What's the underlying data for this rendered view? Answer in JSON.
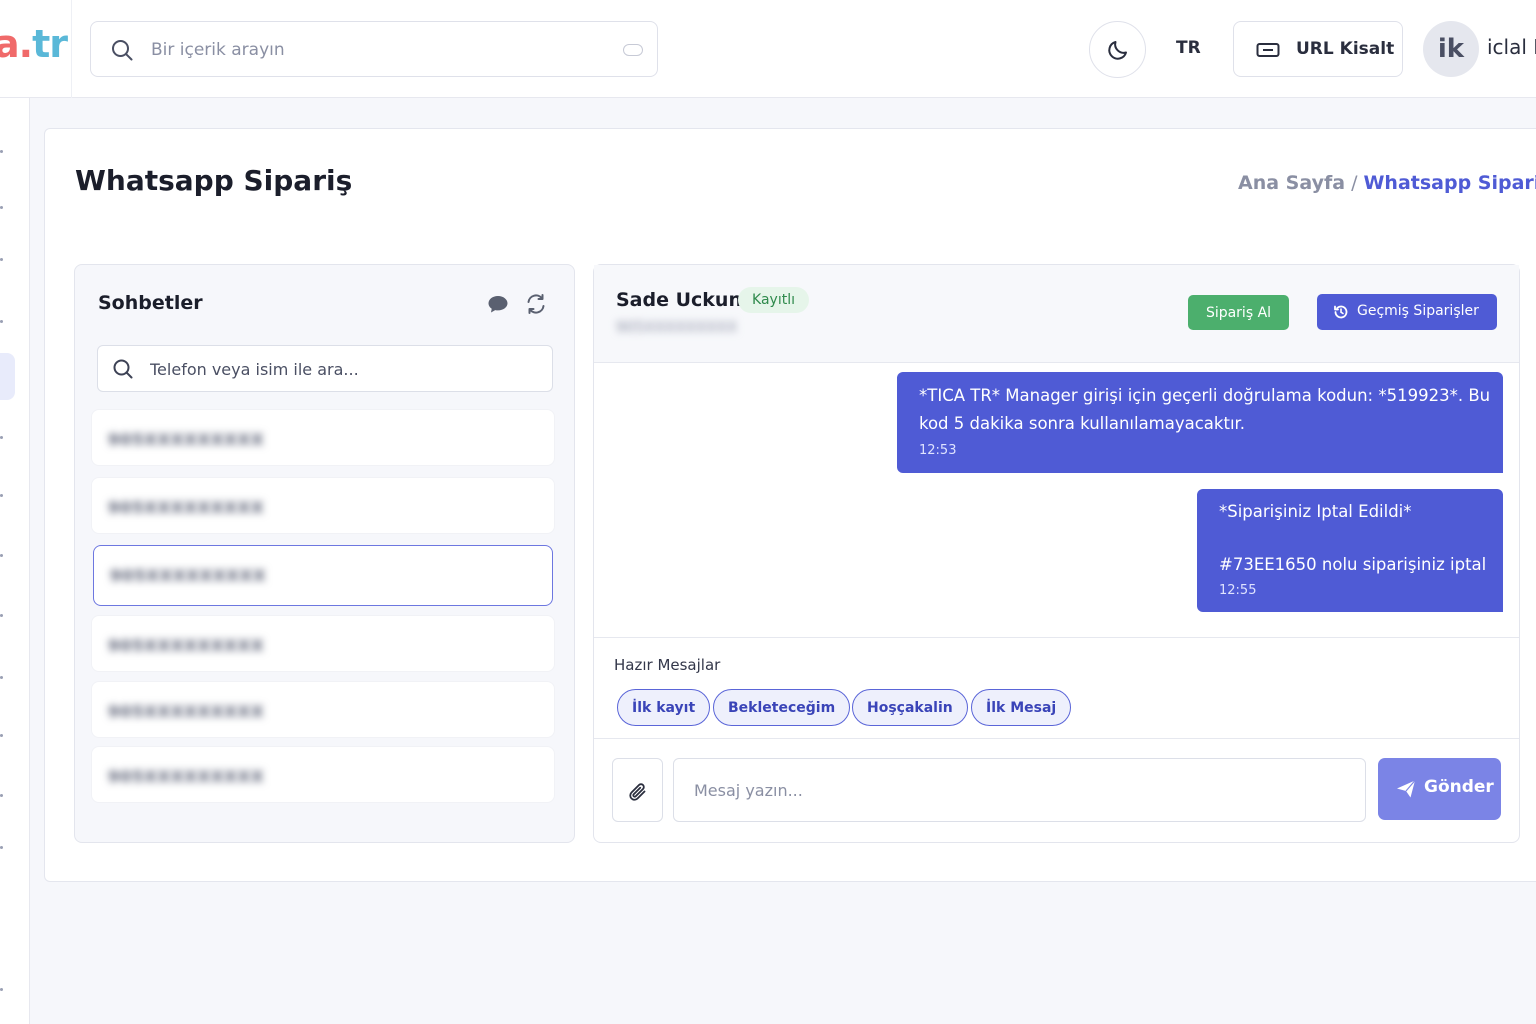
{
  "topbar": {
    "logo": {
      "a": "a",
      "dot": ".",
      "tr": "tr"
    },
    "search_placeholder": "Bir içerik arayın",
    "language": "TR",
    "url_button_label": "URL Kisalt",
    "avatar_initials": "ik",
    "user_name": "iclal K"
  },
  "page": {
    "title": "Whatsapp Sipariş",
    "breadcrumb": {
      "home": "Ana Sayfa",
      "separator": "/",
      "current": "Whatsapp Sipariş"
    }
  },
  "chats": {
    "title": "Sohbetler",
    "search_placeholder": "Telefon veya isim ile ara...",
    "items": [
      {
        "label": "905XXXXXXXXX",
        "selected": false
      },
      {
        "label": "905XXXXXXXXX",
        "selected": false
      },
      {
        "label": "905XXXXXXXXX",
        "selected": true
      },
      {
        "label": "905XXXXXXXXX",
        "selected": false
      },
      {
        "label": "905XXXXXXXXX",
        "selected": false
      },
      {
        "label": "905XXXXXXXXX",
        "selected": false
      }
    ]
  },
  "conversation": {
    "contact_name": "Sade Uckun",
    "badge": "Kayıtlı",
    "phone": "905XXXXXXXXX",
    "order_button": "Sipariş Al",
    "history_button": "Geçmiş Siparişler",
    "messages": [
      {
        "lines": [
          "*TICA TR* Manager girişi için geçerli doğrulama kodun: *519923*. Bu",
          "kod 5 dakika sonra kullanılamayacaktır."
        ],
        "time": "12:53"
      },
      {
        "lines": [
          "*Siparişiniz Iptal Edildi*",
          "",
          "#73EE1650 nolu siparişiniz iptal"
        ],
        "time": "12:55"
      }
    ],
    "quick_title": "Hazır Mesajlar",
    "quick_replies": [
      "İlk kayıt",
      "Bekleteceğim",
      "Hoşçakalin",
      "İlk Mesaj"
    ],
    "input_placeholder": "Mesaj yazın...",
    "send_button": "Gönder"
  },
  "colors": {
    "accent": "#4f5bd5",
    "success": "#4caf6d",
    "send_button": "#7b84e6",
    "logo_red": "#f06a6a",
    "logo_blue": "#5ab8d8"
  }
}
